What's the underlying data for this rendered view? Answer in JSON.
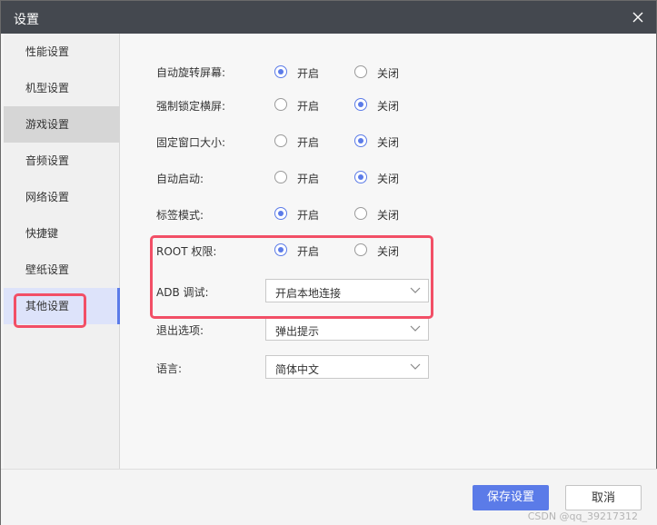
{
  "window": {
    "title": "设置"
  },
  "sidebar": {
    "items": [
      {
        "label": "性能设置"
      },
      {
        "label": "机型设置"
      },
      {
        "label": "游戏设置"
      },
      {
        "label": "音频设置"
      },
      {
        "label": "网络设置"
      },
      {
        "label": "快捷键"
      },
      {
        "label": "壁纸设置"
      },
      {
        "label": "其他设置"
      }
    ],
    "selected": "其他设置",
    "hovered": "游戏设置"
  },
  "settings": {
    "rows": [
      {
        "label": "自动旋转屏幕:",
        "on": "开启",
        "off": "关闭",
        "value": "开启"
      },
      {
        "label": "强制锁定横屏:",
        "on": "开启",
        "off": "关闭",
        "value": "关闭"
      },
      {
        "label": "固定窗口大小:",
        "on": "开启",
        "off": "关闭",
        "value": "关闭"
      },
      {
        "label": "自动启动:",
        "on": "开启",
        "off": "关闭",
        "value": "关闭"
      },
      {
        "label": "标签模式:",
        "on": "开启",
        "off": "关闭",
        "value": "开启"
      },
      {
        "label": "ROOT 权限:",
        "on": "开启",
        "off": "关闭",
        "value": "开启"
      }
    ],
    "adb": {
      "label": "ADB 调试:",
      "value": "开启本地连接"
    },
    "exit": {
      "label": "退出选项:",
      "value": "弹出提示"
    },
    "language": {
      "label": "语言:",
      "value": "简体中文"
    }
  },
  "footer": {
    "save_label": "保存设置",
    "cancel_label": "取消"
  },
  "watermark": "CSDN @qq_39217312",
  "colors": {
    "accent": "#5b7be8",
    "highlight": "#f24f66",
    "titlebar": "#44484f"
  }
}
